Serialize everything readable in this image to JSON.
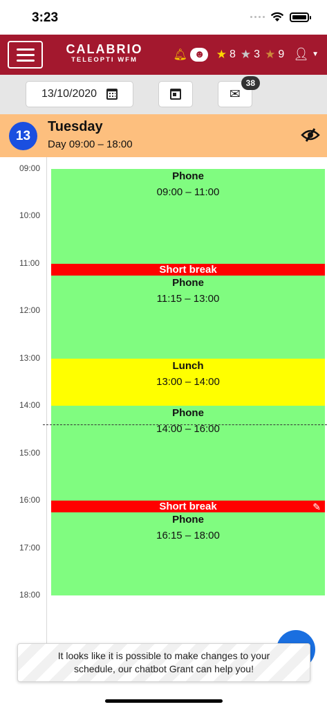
{
  "status_bar": {
    "time": "3:23"
  },
  "header": {
    "logo_main": "CALABRIO",
    "logo_sub": "TELEOPTI WFM",
    "gold_count": "8",
    "silver_count": "3",
    "bronze_count": "9"
  },
  "toolbar": {
    "date_value": "13/10/2020",
    "message_badge": "38"
  },
  "day": {
    "number": "13",
    "name": "Tuesday",
    "shift": "Day  09:00 – 18:00"
  },
  "timeline": {
    "hours": [
      "09:00",
      "10:00",
      "11:00",
      "12:00",
      "13:00",
      "14:00",
      "15:00",
      "16:00",
      "17:00",
      "18:00"
    ]
  },
  "activities": [
    {
      "name": "Phone",
      "time": "09:00 – 11:00",
      "color": "#80fc80"
    },
    {
      "name": "Short break",
      "time": "",
      "color": "#ff0000"
    },
    {
      "name": "Phone",
      "time": "11:15 – 13:00",
      "color": "#80fc80"
    },
    {
      "name": "Lunch",
      "time": "13:00 – 14:00",
      "color": "#ffff00"
    },
    {
      "name": "Phone",
      "time": "14:00 – 16:00",
      "color": "#80fc80"
    },
    {
      "name": "Short break",
      "time": "",
      "color": "#ff0000"
    },
    {
      "name": "Phone",
      "time": "16:15 – 18:00",
      "color": "#80fc80"
    }
  ],
  "chatbot": {
    "message": "It looks like it is possible to make changes to your schedule, our chatbot Grant can help you!"
  },
  "colors": {
    "header_bg": "#a3182e",
    "day_header_bg": "#fdbf7e",
    "day_badge": "#1a4fe0",
    "toolbar_bg": "#e6e6e6"
  }
}
